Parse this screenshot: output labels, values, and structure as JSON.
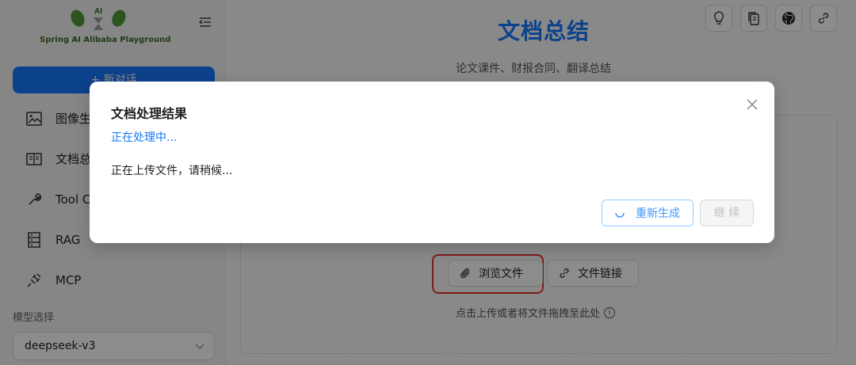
{
  "sidebar": {
    "logo_text": "Spring AI Alibaba Playground",
    "new_chat_label": "+ 新对话",
    "items": [
      {
        "label": "图像生成",
        "icon": "image-icon"
      },
      {
        "label": "文档总结",
        "icon": "book-icon"
      },
      {
        "label": "Tool Calling",
        "icon": "wrench-icon"
      },
      {
        "label": "RAG",
        "icon": "database-icon"
      },
      {
        "label": "MCP",
        "icon": "plug-icon"
      }
    ],
    "model_label": "模型选择",
    "model_value": "deepseek-v3"
  },
  "main": {
    "title": "文档总结",
    "subtitle": "论文课件、财报合同、翻译总结",
    "toolbar_icons": [
      "lightbulb-icon",
      "copy-icon",
      "github-icon",
      "link-icon"
    ],
    "browse_label": "浏览文件",
    "link_label": "文件链接",
    "drop_hint": "点击上传或者将文件拖拽至此处"
  },
  "modal": {
    "title": "文档处理结果",
    "status": "正在处理中...",
    "message": "正在上传文件，请稍候...",
    "regenerate_label": "重新生成",
    "continue_label": "继 续"
  },
  "colors": {
    "accent": "#1677ff",
    "highlight": "#e5322d"
  }
}
